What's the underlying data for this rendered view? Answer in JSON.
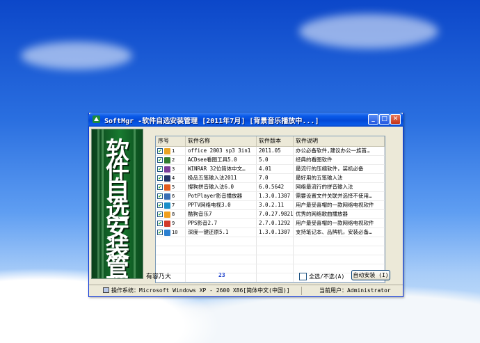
{
  "window": {
    "title": "SoftMgr -软件自选安装管理  [2011年7月] [背景音乐播放中...]",
    "min_glyph": "_",
    "max_glyph": "□",
    "close_glyph": "✕"
  },
  "banner": {
    "text": "软件自选安装管理"
  },
  "table": {
    "headers": [
      "序号",
      "软件名称",
      "软件版本",
      "软件说明"
    ],
    "rows": [
      {
        "idx": "1",
        "name": "office 2003 sp3 3in1",
        "version": "2011.05",
        "desc": "办公必备软件,建议办公一族首…",
        "icon_color": "#e8a323",
        "checked": "✔"
      },
      {
        "idx": "2",
        "name": "ACDsee看图工具5.0",
        "version": "5.0",
        "desc": "经典的看图软件",
        "icon_color": "#2f7b2f",
        "checked": "✔"
      },
      {
        "idx": "3",
        "name": "WINRAR 32位简体中文…",
        "version": "4.01",
        "desc": "最流行的压缩软件，装机必备",
        "icon_color": "#7a3c9a",
        "checked": "✔"
      },
      {
        "idx": "4",
        "name": "极品五笔输入法2011",
        "version": "7.0",
        "desc": "最好用的五笔输入法",
        "icon_color": "#223366",
        "checked": "✔"
      },
      {
        "idx": "5",
        "name": "搜狗拼音输入法6.0",
        "version": "6.0.5642",
        "desc": "网络最流行的拼音输入法",
        "icon_color": "#e25c1e",
        "checked": "✔"
      },
      {
        "idx": "6",
        "name": "PotPlayer影音播放器",
        "version": "1.3.0.1307",
        "desc": "需要设置文件关联并选择不使用…",
        "icon_color": "#3a6fb4",
        "checked": "✔"
      },
      {
        "idx": "7",
        "name": "PPTV网络电视3.0",
        "version": "3.0.2.11",
        "desc": "用户最受喜帽的一款网络电视软件",
        "icon_color": "#1a8fc9",
        "checked": "✔"
      },
      {
        "idx": "8",
        "name": "酷狗音乐7",
        "version": "7.0.27.9821",
        "desc": "优秀的网络歌曲播放器",
        "icon_color": "#f0a020",
        "checked": "✔"
      },
      {
        "idx": "9",
        "name": "PPS影音2.7",
        "version": "2.7.0.1292",
        "desc": "用户最受喜帽的一款网络电视软件",
        "icon_color": "#d23a2a",
        "checked": "✔"
      },
      {
        "idx": "10",
        "name": "深度一键还原5.1",
        "version": "1.3.0.1307",
        "desc": "支持笔记本、品牌机，安装必备…",
        "icon_color": "#2a7fd0",
        "checked": "✔"
      }
    ]
  },
  "footer": {
    "capacity_label": "有容乃大",
    "count": "23",
    "select_all_label": "全选/不选(A)",
    "auto_install_label": "自动安装 (I)"
  },
  "statusbar": {
    "os_text": "操作系统：Microsoft Windows XP - 2600 X86[简体中文(中国)]",
    "user_text": "当前用户：Administrator"
  }
}
